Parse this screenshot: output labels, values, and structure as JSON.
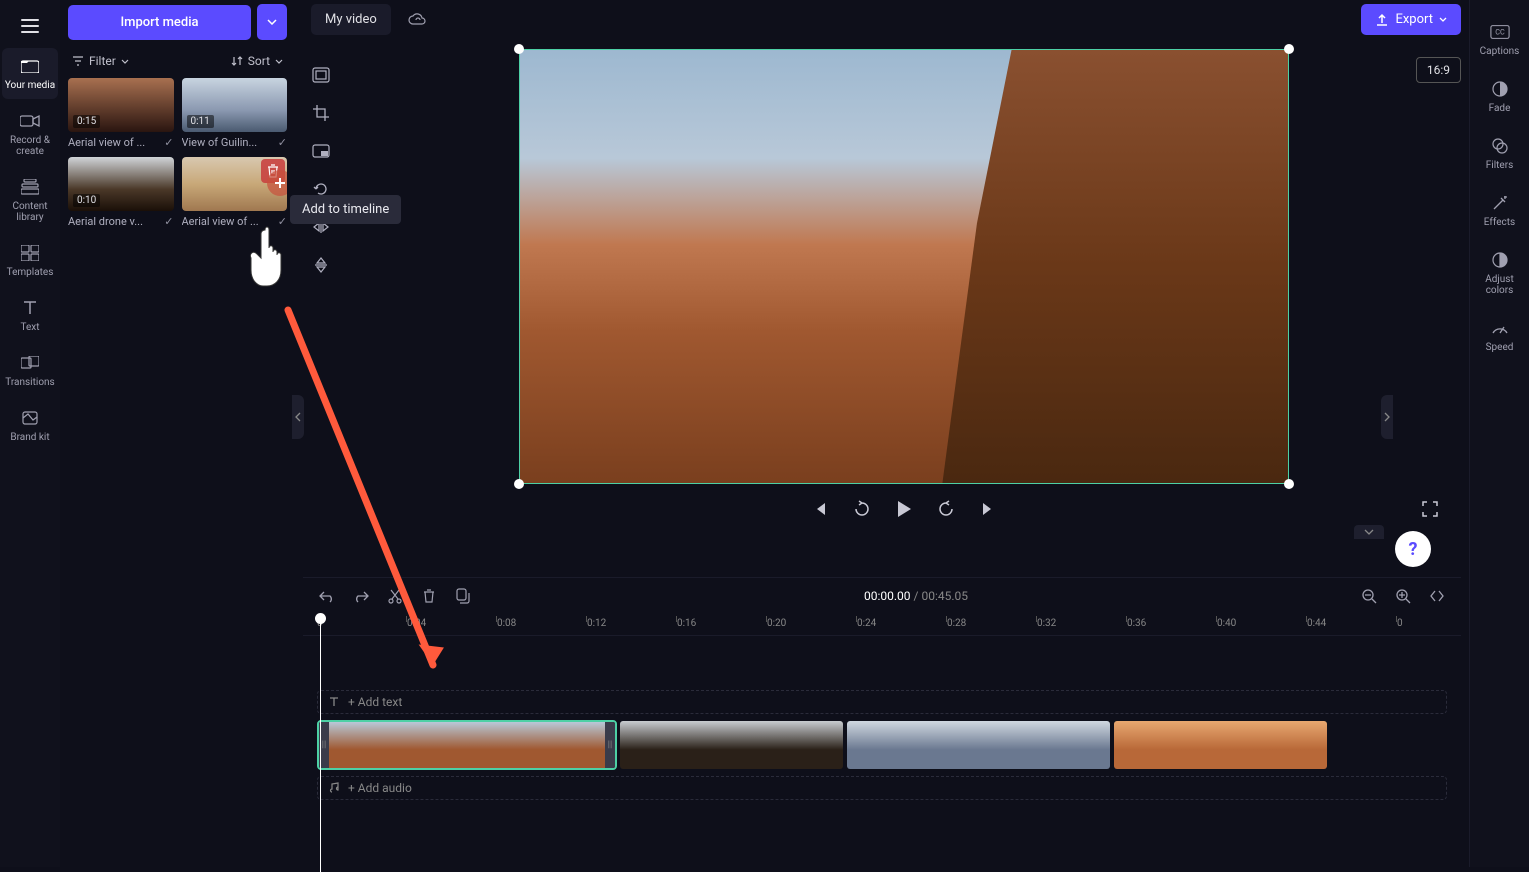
{
  "header": {
    "import_label": "Import media",
    "title": "My video",
    "export_label": "Export",
    "aspect_ratio": "16:9"
  },
  "left_rail": [
    {
      "label": "Your media",
      "icon": "folder"
    },
    {
      "label": "Record & create",
      "icon": "camera"
    },
    {
      "label": "Content library",
      "icon": "library"
    },
    {
      "label": "Templates",
      "icon": "templates"
    },
    {
      "label": "Text",
      "icon": "text"
    },
    {
      "label": "Transitions",
      "icon": "transitions"
    },
    {
      "label": "Brand kit",
      "icon": "brand"
    }
  ],
  "media_panel": {
    "filter_label": "Filter",
    "sort_label": "Sort",
    "tiles": [
      {
        "dur": "0:15",
        "name": "Aerial view of ..."
      },
      {
        "dur": "0:11",
        "name": "View of Guilin..."
      },
      {
        "dur": "0:10",
        "name": "Aerial drone v..."
      },
      {
        "dur": "",
        "name": "Aerial view of ..."
      }
    ],
    "tooltip": "Add to timeline"
  },
  "player": {
    "current": "00:00.00",
    "sep": " / ",
    "total": "00:45.05"
  },
  "timeline": {
    "add_text": "+ Add text",
    "add_audio": "+ Add audio",
    "ticks": [
      "0",
      "0:04",
      "0:08",
      "0:12",
      "0:16",
      "0:20",
      "0:24",
      "0:28",
      "0:32",
      "0:36",
      "0:40",
      "0:44",
      "0"
    ]
  },
  "right_rail": [
    {
      "label": "Captions",
      "icon": "cc"
    },
    {
      "label": "Fade",
      "icon": "fade"
    },
    {
      "label": "Filters",
      "icon": "filters"
    },
    {
      "label": "Effects",
      "icon": "effects"
    },
    {
      "label": "Adjust colors",
      "icon": "adjust"
    },
    {
      "label": "Speed",
      "icon": "speed"
    }
  ]
}
